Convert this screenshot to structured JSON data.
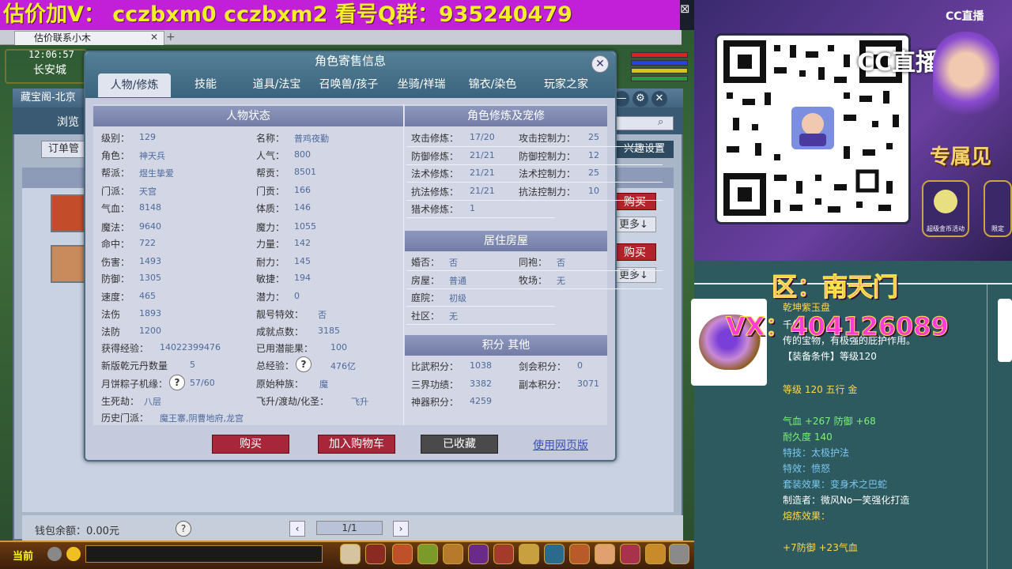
{
  "banner": {
    "text": "估价加V：  cczbxm0   cczbxm2   看号Q群：935240479"
  },
  "browser_tab": {
    "label": "估价联系小木"
  },
  "game": {
    "clock": "12:06:57",
    "city": "长安城"
  },
  "store": {
    "title": "藏宝阁-北京",
    "browse_label": "浏览",
    "order_label": "订单管",
    "interest_label": "兴趣设置",
    "buy_label": "购买",
    "more_label": "更多↓",
    "wallet": "钱包余额：0.00元",
    "page": "1/1"
  },
  "bottom": {
    "current": "当前"
  },
  "modal": {
    "title": "角色寄售信息",
    "tabs": [
      "人物/修炼",
      "技能",
      "道具/法宝",
      "召唤兽/孩子",
      "坐骑/祥瑞",
      "锦衣/染色",
      "玩家之家"
    ],
    "status_header": "人物状态",
    "status_left": [
      {
        "label": "级别：",
        "value": "129"
      },
      {
        "label": "角色：",
        "value": "神天兵"
      },
      {
        "label": "帮派：",
        "value": "煜生挚爱"
      },
      {
        "label": "门派：",
        "value": "天宫"
      },
      {
        "label": "气血：",
        "value": "8148"
      },
      {
        "label": "魔法：",
        "value": "9640"
      },
      {
        "label": "命中：",
        "value": "722"
      },
      {
        "label": "伤害：",
        "value": "1493"
      },
      {
        "label": "防御：",
        "value": "1305"
      },
      {
        "label": "速度：",
        "value": "465"
      },
      {
        "label": "法伤",
        "value": "1893"
      },
      {
        "label": "法防",
        "value": "1200"
      }
    ],
    "status_right": [
      {
        "label": "名称：",
        "value": "普鸡夜勤"
      },
      {
        "label": "人气：",
        "value": "800"
      },
      {
        "label": "帮贡：",
        "value": "8501"
      },
      {
        "label": "门贡：",
        "value": "166"
      },
      {
        "label": "体质：",
        "value": "146"
      },
      {
        "label": "魔力：",
        "value": "1055"
      },
      {
        "label": "力量：",
        "value": "142"
      },
      {
        "label": "耐力：",
        "value": "145"
      },
      {
        "label": "敏捷：",
        "value": "194"
      },
      {
        "label": "潜力：",
        "value": "0"
      },
      {
        "label": "靓号特效：",
        "value": "否"
      },
      {
        "label": "成就点数：",
        "value": "3185"
      }
    ],
    "extra": {
      "exp_label": "获得经验：",
      "exp_value": "14022399476",
      "used_label": "已用潜能果：",
      "used_value": "100",
      "qianyuan_label": "新版乾元丹数量",
      "qianyuan_value": "5",
      "total_exp_label": "总经验：",
      "total_exp_value": "476亿",
      "zongzi_label": "月饼粽子机缘：",
      "zongzi_value": "57/60",
      "race_label": "原始种族：",
      "race_value": "魔",
      "shengsi_label": "生死劫：",
      "shengsi_value": "八层",
      "feisheng_label": "飞升/渡劫/化圣：",
      "feisheng_value": "飞升",
      "history_label": "历史门派：",
      "history_value": "魔王寨,阴曹地府,龙宫",
      "help": "?"
    },
    "cultivation_header": "角色修炼及宠修",
    "cultivation_left": [
      {
        "label": "攻击修炼：",
        "value": "17/20"
      },
      {
        "label": "防御修炼：",
        "value": "21/21"
      },
      {
        "label": "法术修炼：",
        "value": "21/21"
      },
      {
        "label": "抗法修炼：",
        "value": "21/21"
      },
      {
        "label": "猎术修炼：",
        "value": "1"
      }
    ],
    "cultivation_right": [
      {
        "label": "攻击控制力：",
        "value": "25"
      },
      {
        "label": "防御控制力：",
        "value": "12"
      },
      {
        "label": "法术控制力：",
        "value": "25"
      },
      {
        "label": "抗法控制力：",
        "value": "10"
      }
    ],
    "house_header": "居住房屋",
    "house_left": [
      {
        "label": "婚否：",
        "value": "否"
      },
      {
        "label": "房屋：",
        "value": "普通"
      },
      {
        "label": "庭院：",
        "value": "初级"
      },
      {
        "label": "社区：",
        "value": "无"
      }
    ],
    "house_right": [
      {
        "label": "同袍：",
        "value": "否"
      },
      {
        "label": "牧场：",
        "value": "无"
      }
    ],
    "points_header": "积分 其他",
    "points": [
      {
        "label": "比武积分：",
        "value": "1038"
      },
      {
        "label": "剑会积分：",
        "value": "0"
      },
      {
        "label": "三界功绩：",
        "value": "3382"
      },
      {
        "label": "副本积分：",
        "value": "3071"
      },
      {
        "label": "神器积分：",
        "value": "4259"
      }
    ],
    "buttons": {
      "buy": "购买",
      "cart": "加入购物车",
      "saved": "已收藏",
      "web": "使用网页版"
    }
  },
  "stream": {
    "cc_logo": "CC直播",
    "cc_big": "CC直播",
    "exclusive": "专属见",
    "badge1": "超级金币活动",
    "badge2": "限定",
    "region": "区：南天门",
    "vx": "VX：404126089"
  },
  "item": {
    "name": "乾坤紫玉盘",
    "desc1": "千年",
    "desc2": "传的宝物，有极强的庇护作用。",
    "req": "【装备条件】等级120",
    "level": "等级 120  五行 金",
    "stats1": "气血 +267 防御 +68",
    "durability": "耐久度 140",
    "skill": "特技：太极护法",
    "effect": "特效：愤怒",
    "set": "套装效果：变身术之巴蛇",
    "maker": "制造者：微风No一笑强化打造",
    "refine": "熔炼效果：",
    "refine_val": "+7防御 +23气血"
  },
  "colors": {
    "accent": "#3a647d",
    "buy_red": "#a8263a",
    "value_blue": "#4e6a9a"
  }
}
